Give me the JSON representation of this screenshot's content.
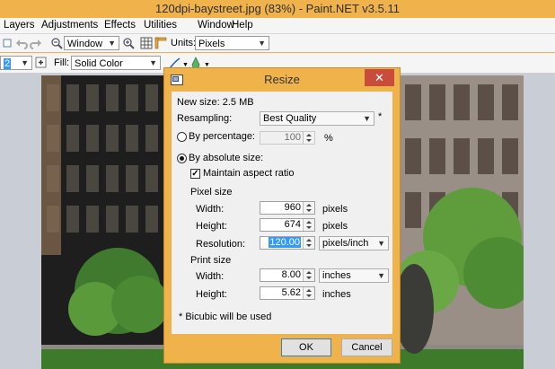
{
  "window": {
    "title": "120dpi-baystreet.jpg (83%) - Paint.NET v3.5.11"
  },
  "menu": [
    "Layers",
    "Adjustments",
    "Effects",
    "Utilities",
    "Window",
    "Help"
  ],
  "toolbar": {
    "view_combo": "Window",
    "units_label": "Units:",
    "units_value": "Pixels"
  },
  "toolbar2": {
    "brush_width": "2",
    "fill_label": "Fill:",
    "fill_value": "Solid Color"
  },
  "dialog": {
    "title": "Resize",
    "close_glyph": "✕",
    "new_size": "New size: 2.5 MB",
    "resampling_label": "Resampling:",
    "resampling_value": "Best Quality",
    "resampling_note": "*",
    "by_percentage_label": "By percentage:",
    "percentage_value": "100",
    "percent_unit": "%",
    "by_absolute_label": "By absolute size:",
    "maintain_aspect_label": "Maintain aspect ratio",
    "maintain_aspect_checked": true,
    "pixel_size_header": "Pixel size",
    "width_label": "Width:",
    "pixel_width": "960",
    "pixel_width_unit": "pixels",
    "height_label": "Height:",
    "pixel_height": "674",
    "pixel_height_unit": "pixels",
    "resolution_label": "Resolution:",
    "resolution_value": "120.00",
    "resolution_unit": "pixels/inch",
    "print_size_header": "Print size",
    "print_width_label": "Width:",
    "print_width": "8.00",
    "print_width_unit": "inches",
    "print_height_label": "Height:",
    "print_height": "5.62",
    "print_height_unit": "inches",
    "footnote": "* Bicubic will be used",
    "ok_label": "OK",
    "cancel_label": "Cancel"
  },
  "colors": {
    "title_accent": "#f0b24a",
    "close_button": "#c84b3c",
    "selection": "#3399ff"
  }
}
